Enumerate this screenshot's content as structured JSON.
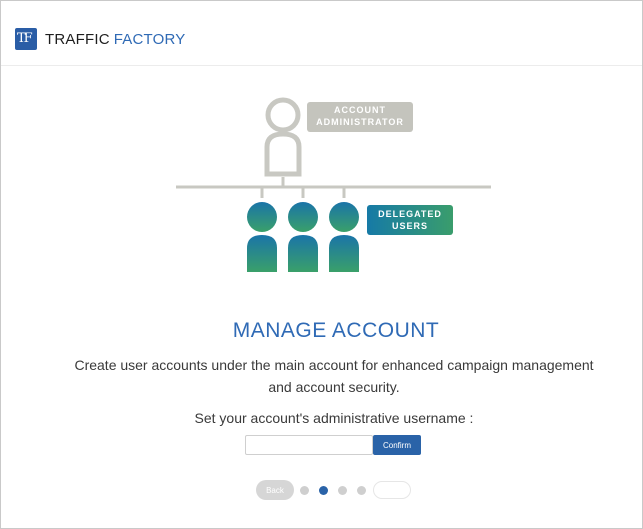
{
  "header": {
    "brand_primary": "TRAFFIC",
    "brand_secondary": "FACTORY",
    "brand_color": "#2f6ab5"
  },
  "illustration": {
    "admin_tag_line1": "ACCOUNT",
    "admin_tag_line2": "ADMINISTRATOR",
    "delegated_tag_line1": "DELEGATED",
    "delegated_tag_line2": "USERS"
  },
  "main": {
    "title": "MANAGE ACCOUNT",
    "description_line1": "Create user accounts under the main account for enhanced campaign management",
    "description_line2": "and account security.",
    "prompt": "Set your account's administrative username :",
    "username_value": "",
    "confirm_label": "Confirm"
  },
  "pager": {
    "back_label": "Back",
    "step_count": 4,
    "active_step": 2
  },
  "colors": {
    "accent": "#2a63a8",
    "admin_gray": "#c4c4bd",
    "user_teal": "#1f7da0",
    "user_green": "#3a9d6c"
  }
}
